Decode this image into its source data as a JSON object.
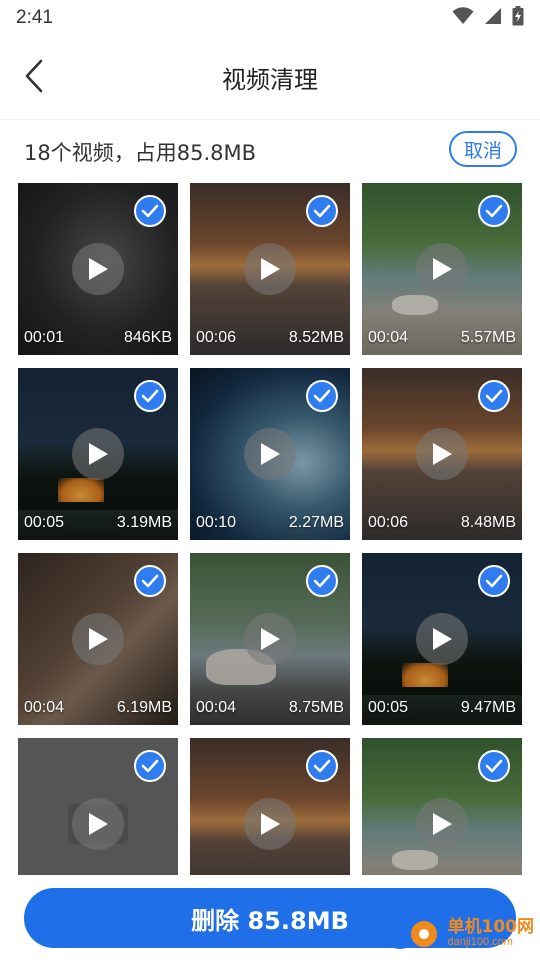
{
  "status_bar": {
    "time": "2:41",
    "icons": [
      "wifi-icon",
      "signal-icon",
      "battery-charging-icon"
    ]
  },
  "header": {
    "back_icon": "chevron-left-icon",
    "title": "视频清理"
  },
  "summary": {
    "text": "18个视频，占用85.8MB",
    "cancel_label": "取消"
  },
  "videos": [
    {
      "duration": "00:01",
      "size": "846KB",
      "selected": true
    },
    {
      "duration": "00:06",
      "size": "8.52MB",
      "selected": true
    },
    {
      "duration": "00:04",
      "size": "5.57MB",
      "selected": true
    },
    {
      "duration": "00:05",
      "size": "3.19MB",
      "selected": true
    },
    {
      "duration": "00:10",
      "size": "2.27MB",
      "selected": true
    },
    {
      "duration": "00:06",
      "size": "8.48MB",
      "selected": true
    },
    {
      "duration": "00:04",
      "size": "6.19MB",
      "selected": true
    },
    {
      "duration": "00:04",
      "size": "8.75MB",
      "selected": true
    },
    {
      "duration": "00:05",
      "size": "9.47MB",
      "selected": true
    },
    {
      "duration": "",
      "size": "",
      "selected": true
    },
    {
      "duration": "",
      "size": "",
      "selected": true
    },
    {
      "duration": "",
      "size": "",
      "selected": true
    }
  ],
  "footer": {
    "delete_label": "删除 85.8MB"
  },
  "watermark": {
    "cn": "单机100网",
    "en": "danji100.com"
  },
  "colors": {
    "accent": "#1f6fe8",
    "check_badge": "#2f7bf0",
    "watermark": "#f08a1c"
  }
}
